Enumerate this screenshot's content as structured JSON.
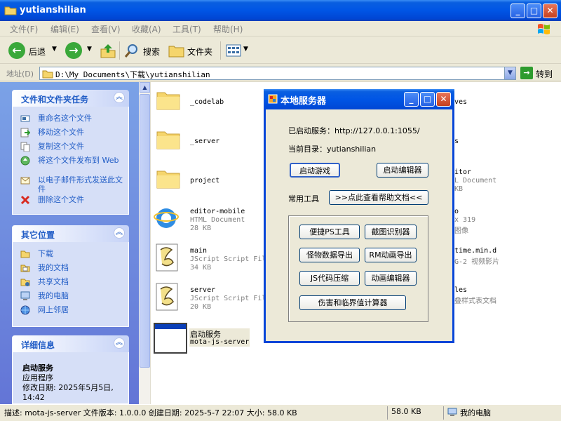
{
  "window": {
    "title": "yutianshilian"
  },
  "menu": [
    "文件(F)",
    "编辑(E)",
    "查看(V)",
    "收藏(A)",
    "工具(T)",
    "帮助(H)"
  ],
  "toolbar": {
    "back": "后退",
    "search": "搜索",
    "folders": "文件夹"
  },
  "address": {
    "label": "地址(D)",
    "value": "D:\\My Documents\\下载\\yutianshilian",
    "go": "转到"
  },
  "sidebar": {
    "tasks_title": "文件和文件夹任务",
    "tasks": [
      "重命名这个文件",
      "移动这个文件",
      "复制这个文件",
      "将这个文件发布到 Web",
      "以电子邮件形式发送此文件",
      "删除这个文件"
    ],
    "places_title": "其它位置",
    "places": [
      "下载",
      "我的文档",
      "共享文档",
      "我的电脑",
      "网上邻居"
    ],
    "details_title": "详细信息",
    "details_name": "启动服务",
    "details_type": "应用程序",
    "details_modified": "修改日期: 2025年5月5日, 14:42"
  },
  "files": [
    {
      "name": "_codelab",
      "line2": "",
      "line3": ""
    },
    {
      "name": "_server",
      "line2": "",
      "line3": ""
    },
    {
      "name": "project",
      "line2": "",
      "line3": ""
    },
    {
      "name": "editor-mobile",
      "line2": "HTML Document",
      "line3": "28 KB"
    },
    {
      "name": "main",
      "line2": "JScript Script Fil",
      "line3": "34 KB"
    },
    {
      "name": "server",
      "line2": "JScript Script Fil",
      "line3": "20 KB"
    },
    {
      "name": "启动服务",
      "line2": "mota-js-server",
      "line3": ""
    }
  ],
  "files_right": [
    {
      "line1": "ves",
      "line2": "",
      "line3": ""
    },
    {
      "line1": "s",
      "line2": "",
      "line3": ""
    },
    {
      "line1": "itor",
      "line2": "L Document",
      "line3": "KB"
    },
    {
      "line1": "o",
      "line2": "x 319",
      "line3": "图像"
    },
    {
      "line1": "time.min.d",
      "line2": "G-2 视频影片",
      "line3": ""
    },
    {
      "line1": "les",
      "line2": "叠样式表文档",
      "line3": ""
    }
  ],
  "status": {
    "description": "描述: mota-js-server 文件版本: 1.0.0.0 创建日期: 2025-5-7 22:07 大小: 58.0 KB",
    "size": "58.0 KB",
    "location": "我的电脑"
  },
  "dialog": {
    "title": "本地服务器",
    "server_line": "已启动服务：http://127.0.0.1:1055/",
    "dir_line": "当前目录：yutianshilian",
    "start_game": "启动游戏",
    "start_editor": "启动编辑器",
    "common_tools": "常用工具",
    "help_doc": ">>点此查看帮助文档<<",
    "tools": [
      "便捷PS工具",
      "截图识别器",
      "怪物数据导出",
      "RM动画导出",
      "JS代码压缩",
      "动画编辑器",
      "伤害和临界值计算器"
    ]
  }
}
